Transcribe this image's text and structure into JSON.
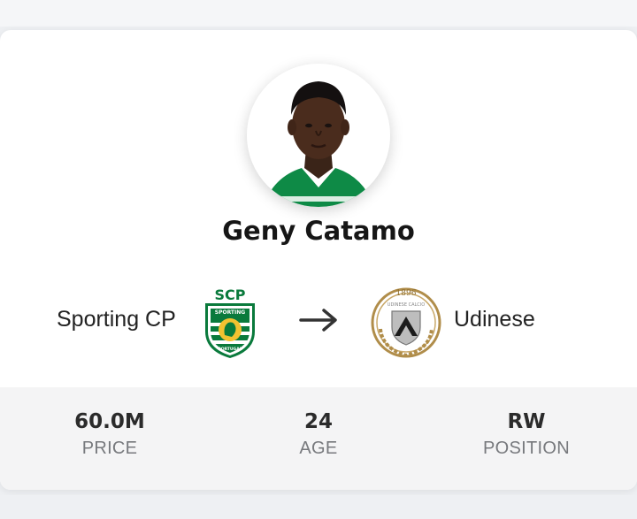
{
  "player": {
    "name": "Geny Catamo"
  },
  "transfer": {
    "from_club": "Sporting CP",
    "to_club": "Udinese",
    "from_crest_text_top": "SCP",
    "from_crest_text_band": "SPORTING",
    "from_crest_text_bottom": "PORTUGAL",
    "to_crest_year": "1896",
    "to_crest_text": "UDINESE CALCIO"
  },
  "stats": {
    "price": {
      "value": "60.0M",
      "label": "PRICE"
    },
    "age": {
      "value": "24",
      "label": "AGE"
    },
    "position": {
      "value": "RW",
      "label": "POSITION"
    }
  },
  "colors": {
    "sporting_green": "#0a7a3c",
    "udinese_gold": "#b08d4a",
    "text_dark": "#161616",
    "label_grey": "#77797d"
  }
}
